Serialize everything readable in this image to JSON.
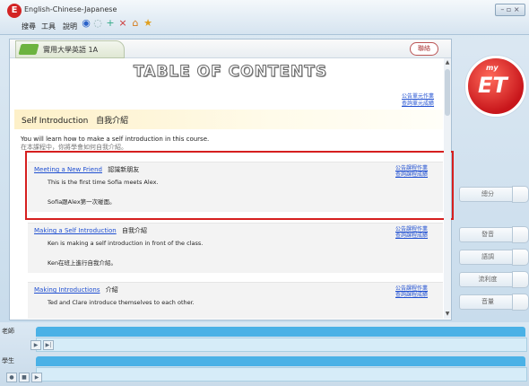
{
  "app": {
    "title": "English-Chinese-Japanese"
  },
  "menu": [
    "搜尋",
    "工具",
    "說明"
  ],
  "toolbar_icons": [
    "back-icon",
    "forward-icon",
    "add-icon",
    "close-icon",
    "home-icon",
    "favorite-icon"
  ],
  "book": {
    "badge": "",
    "title": "實用大學英語 1A",
    "search": "聯絡"
  },
  "toc": {
    "heading": "TABLE OF CONTENTS",
    "unit_links": [
      "公告單元作業",
      "查詢單元成績"
    ]
  },
  "section": {
    "title": "Self Introduction",
    "title_zh": "自我介紹",
    "desc_en": "You will learn how to make a self introduction in this course.",
    "desc_zh": "在本課程中，你將學會如何自我介紹。"
  },
  "lessons": [
    {
      "title": "Meeting a New Friend",
      "title_zh": "認識新朋友",
      "link1": "公告課程作業",
      "link2": "查詢課程成績",
      "desc_en": "This is the first time Sofia meets Alex.",
      "desc_zh": "Sofia跟Alex第一次碰面。"
    },
    {
      "title": "Making a Self Introduction",
      "title_zh": "自我介紹",
      "link1": "公告課程作業",
      "link2": "查詢課程成績",
      "desc_en": "Ken is making a self introduction in front of the class.",
      "desc_zh": "Ken在班上進行自我介紹。"
    },
    {
      "title": "Making Introductions",
      "title_zh": "介紹",
      "link1": "公告課程作業",
      "link2": "查詢課程成績",
      "desc_en": "Ted and Clare introduce themselves to each other.",
      "desc_zh": ""
    }
  ],
  "logo": {
    "my": "my",
    "et": "ET"
  },
  "side_buttons": [
    "總分",
    "發音",
    "語調",
    "流利度",
    "音量"
  ],
  "bottom": {
    "teacher_label": "老師",
    "student_label": "學生"
  },
  "colors": {
    "highlight": "#d61f1f",
    "link": "#1f4fd1",
    "track": "#4ab1e6",
    "logo": "#c8161b"
  }
}
